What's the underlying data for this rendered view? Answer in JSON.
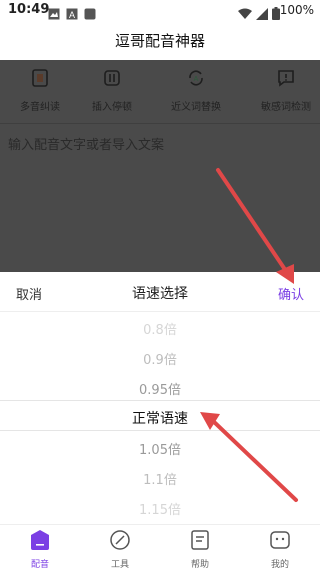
{
  "status_bar": {
    "time": "10:49",
    "battery": "100%",
    "icons": [
      "image-icon",
      "translate-icon",
      "app-icon",
      "wifi-icon",
      "signal-icon",
      "battery-icon"
    ]
  },
  "app": {
    "title": "逗哥配音神器"
  },
  "tools": [
    {
      "label": "多音纠读",
      "icon": "polyphone-icon"
    },
    {
      "label": "插入停顿",
      "icon": "pause-icon"
    },
    {
      "label": "近义词替换",
      "icon": "replace-icon"
    },
    {
      "label": "敏感词检测",
      "icon": "alert-icon"
    }
  ],
  "editor": {
    "placeholder": "输入配音文字或者导入文案"
  },
  "speed_sheet": {
    "cancel": "取消",
    "title": "语速选择",
    "confirm": "确认",
    "options": [
      "0.8倍",
      "0.9倍",
      "0.95倍",
      "正常语速",
      "1.05倍",
      "1.1倍",
      "1.15倍"
    ],
    "selected": "正常语速"
  },
  "tabs": [
    {
      "label": "配音",
      "icon": "dub-icon",
      "active": true
    },
    {
      "label": "工具",
      "icon": "tools-icon",
      "active": false
    },
    {
      "label": "帮助",
      "icon": "help-icon",
      "active": false
    },
    {
      "label": "我的",
      "icon": "profile-icon",
      "active": false
    }
  ],
  "colors": {
    "accent": "#7b3fe4",
    "overlay": "#4a4a4a",
    "annotation_arrow": "#e04848"
  }
}
